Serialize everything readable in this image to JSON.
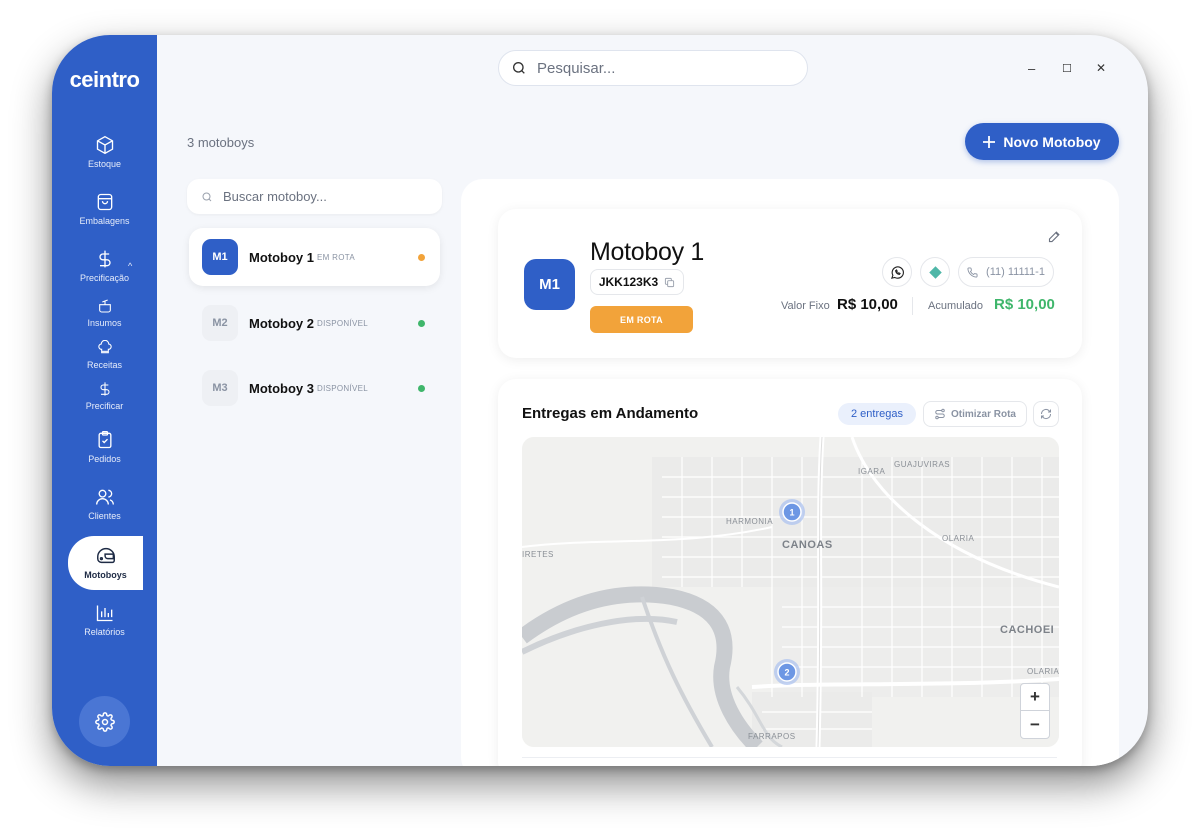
{
  "brand": {
    "logo": "ceintro"
  },
  "sidebar": {
    "items": [
      {
        "label": "Estoque",
        "icon": "box-icon"
      },
      {
        "label": "Embalagens",
        "icon": "bag-icon"
      },
      {
        "label": "Precificação",
        "icon": "dollar-icon"
      },
      {
        "label": "Insumos",
        "icon": "pot-icon"
      },
      {
        "label": "Receitas",
        "icon": "chef-hat-icon"
      },
      {
        "label": "Precificar",
        "icon": "dollar-icon"
      },
      {
        "label": "Pedidos",
        "icon": "clipboard-check-icon"
      },
      {
        "label": "Clientes",
        "icon": "users-icon"
      },
      {
        "label": "Motoboys",
        "icon": "helmet-icon",
        "active": true
      },
      {
        "label": "Relatórios",
        "icon": "bar-chart-icon"
      }
    ],
    "settings_icon": "gear-icon"
  },
  "topbar": {
    "search_placeholder": "Pesquisar...",
    "minimize": "–",
    "maximize": "☐",
    "close": "✕"
  },
  "list": {
    "count_label": "3 motoboys",
    "new_button": "Novo Motoboy",
    "search_placeholder": "Buscar motoboy...",
    "items": [
      {
        "code": "M1",
        "name": "Motoboy 1",
        "status": "EM ROTA",
        "dot_color": "#f2a33a"
      },
      {
        "code": "M2",
        "name": "Motoboy 2",
        "status": "DISPONÍVEL",
        "dot_color": "#3fb66b"
      },
      {
        "code": "M3",
        "name": "Motoboy 3",
        "status": "DISPONÍVEL",
        "dot_color": "#3fb66b"
      }
    ]
  },
  "detail": {
    "code": "M1",
    "name": "Motoboy 1",
    "plate": "JKK123K3",
    "status_badge": "EM ROTA",
    "phone": "(11) 11111-1",
    "fixed_label": "Valor Fixo",
    "fixed_value": "R$ 10,00",
    "acc_label": "Acumulado",
    "acc_value": "R$ 10,00"
  },
  "deliveries": {
    "title": "Entregas em Andamento",
    "count_badge": "2 entregas",
    "optimize_label": "Otimizar Rota",
    "map": {
      "places": [
        "IGARA",
        "GUAJUVIRAS",
        "HARMONIA",
        "CANOAS",
        "OLARIA",
        "IRETES",
        "CACHOEI",
        "OLARIA",
        "FARRAPOS"
      ],
      "markers": [
        "1",
        "2"
      ],
      "zoom_in": "+",
      "zoom_out": "−"
    }
  },
  "colors": {
    "brand": "#2f5fc7",
    "accent_orange": "#f2a33a",
    "green": "#3fb66b"
  }
}
